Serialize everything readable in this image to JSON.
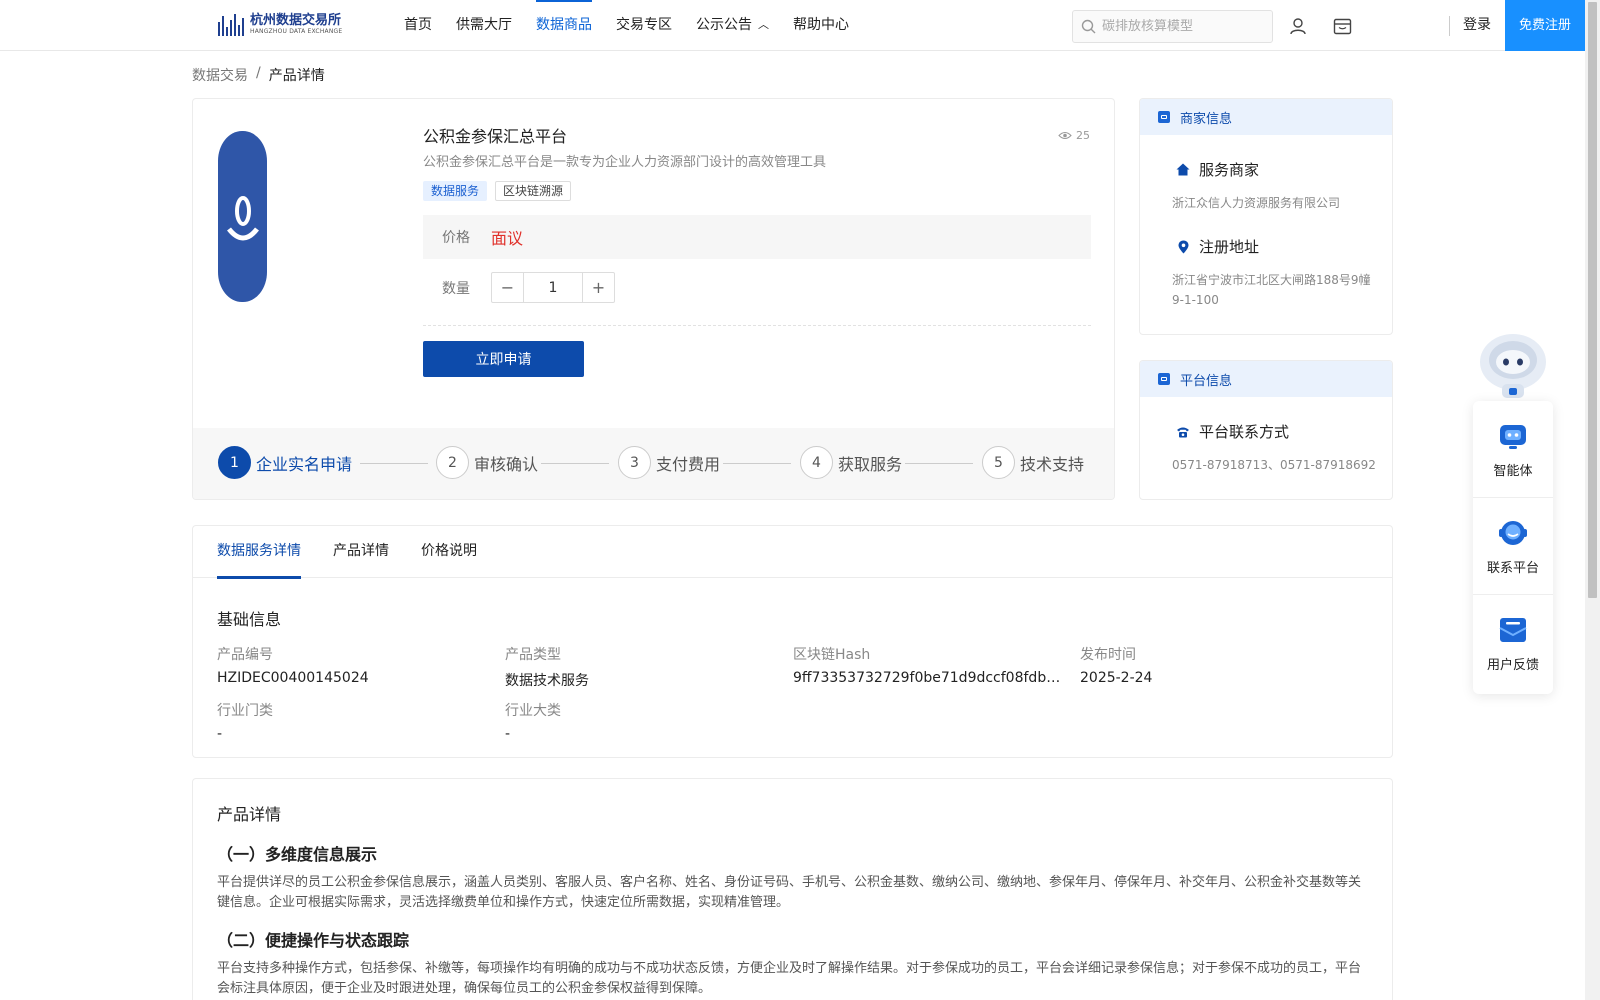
{
  "header": {
    "logo_cn": "杭州数据交易所",
    "logo_en": "HANGZHOU DATA EXCHANGE",
    "nav": [
      {
        "label": "首页"
      },
      {
        "label": "供需大厅"
      },
      {
        "label": "数据商品"
      },
      {
        "label": "交易专区"
      },
      {
        "label": "公示公告"
      },
      {
        "label": "帮助中心"
      }
    ],
    "search_placeholder": "碳排放核算模型",
    "login": "登录",
    "register": "免费注册",
    "accent_color": "#1890ff"
  },
  "breadcrumb": {
    "root": "数据交易",
    "separator": "/",
    "current": "产品详情"
  },
  "product": {
    "title": "公积金参保汇总平台",
    "views": "25",
    "description": "公积金参保汇总平台是一款专为企业人力资源部门设计的高效管理工具",
    "tags": [
      "数据服务",
      "区块链溯源"
    ],
    "price_label": "价格",
    "price_value": "面议",
    "quantity_label": "数量",
    "quantity_value": "1",
    "apply_button": "立即申请",
    "steps": [
      {
        "num": "1",
        "label": "企业实名申请"
      },
      {
        "num": "2",
        "label": "审核确认"
      },
      {
        "num": "3",
        "label": "支付费用"
      },
      {
        "num": "4",
        "label": "获取服务"
      },
      {
        "num": "5",
        "label": "技术支持"
      }
    ],
    "primary_color": "#0d4bab"
  },
  "merchant": {
    "head": "商家信息",
    "service_title": "服务商家",
    "service_name": "浙江众信人力资源服务有限公司",
    "address_title": "注册地址",
    "address_value": "浙江省宁波市江北区大闸路188号9幢9-1-100"
  },
  "platform": {
    "head": "平台信息",
    "contact_title": "平台联系方式",
    "contact_value": "0571-87918713、0571-87918692"
  },
  "detail_tabs": [
    "数据服务详情",
    "产品详情",
    "价格说明"
  ],
  "basic_info": {
    "title": "基础信息",
    "fields": [
      {
        "label": "产品编号",
        "value": "HZIDEC00400145024"
      },
      {
        "label": "产品类型",
        "value": "数据技术服务"
      },
      {
        "label": "区块链Hash",
        "value": "9ff73353732729f0be71d9dccf08fdb581c5…"
      },
      {
        "label": "发布时间",
        "value": "2025-2-24"
      },
      {
        "label": "行业门类",
        "value": "-"
      },
      {
        "label": "行业大类",
        "value": "-"
      }
    ]
  },
  "product_detail": {
    "title": "产品详情",
    "sections": [
      {
        "heading": "（一）多维度信息展示",
        "text": "平台提供详尽的员工公积金参保信息展示，涵盖人员类别、客服人员、客户名称、姓名、身份证号码、手机号、公积金基数、缴纳公司、缴纳地、参保年月、停保年月、补交年月、公积金补交基数等关键信息。企业可根据实际需求，灵活选择缴费单位和操作方式，快速定位所需数据，实现精准管理。"
      },
      {
        "heading": "（二）便捷操作与状态跟踪",
        "text": "平台支持多种操作方式，包括参保、补缴等，每项操作均有明确的成功与不成功状态反馈，方便企业及时了解操作结果。对于参保成功的员工，平台会详细记录参保信息；对于参保不成功的员工，平台会标注具体原因，便于企业及时跟进处理，确保每位员工的公积金参保权益得到保障。"
      }
    ]
  },
  "floating": {
    "items": [
      {
        "label": "智能体",
        "icon": "bot-icon"
      },
      {
        "label": "联系平台",
        "icon": "headset-icon"
      },
      {
        "label": "用户反馈",
        "icon": "feedback-icon"
      }
    ]
  }
}
